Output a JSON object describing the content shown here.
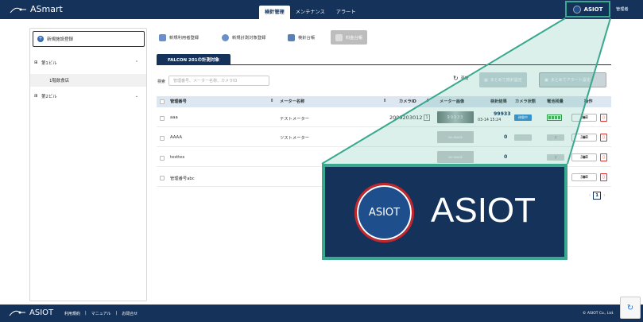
{
  "header": {
    "app_name": "ASmart",
    "tabs": [
      {
        "label": "検針管理",
        "active": true
      },
      {
        "label": "メンテナンス",
        "active": false
      },
      {
        "label": "アラート",
        "active": false
      }
    ],
    "brand": "ASIOT",
    "user": "管理者"
  },
  "sidebar": {
    "new_facility_label": "新規施設登録",
    "tree": [
      {
        "label": "第1ビル",
        "chevron": "^"
      },
      {
        "label": "1階飲食店",
        "sub": true
      },
      {
        "label": "第2ビル",
        "chevron": "v"
      }
    ]
  },
  "toolbar": {
    "new_user": "新規利用者登録",
    "new_target": "新規計測対象登録",
    "ledger": "検針台帳",
    "fee_ledger": "料金台帳"
  },
  "target_tab": "FALCON 201の計測対象",
  "search": {
    "label": "検索",
    "placeholder": "管理番号、メーター名称、カメラID"
  },
  "update_label": "更新",
  "bulk_buttons": {
    "config": "まとめて検針設定",
    "alert": "まとめてアラート設定"
  },
  "table": {
    "headers": [
      "管理番号",
      "メーター名称",
      "カメラID",
      "メーター画像",
      "検針結果",
      "カメラ状態",
      "電池残量",
      "操作"
    ],
    "rows": [
      {
        "id": "aaa",
        "meter": "テストメーター",
        "camera": "2009203012",
        "cam_tag": "1",
        "image": "REAL",
        "image_text": "99933",
        "value": "99933",
        "date": "03-14 15:24",
        "status": "稼働中",
        "status_color": "#3a8fd6",
        "battery": true
      },
      {
        "id": "AAAA",
        "meter": "ツストメーター",
        "camera": "",
        "cam_tag": "",
        "image": "NO IMAGE",
        "image_text": "NO IMAGE",
        "value": "0",
        "date": "",
        "status": "",
        "status_color": "#cfd4d4",
        "battery_q": "?"
      },
      {
        "id": "testtes",
        "meter": "",
        "camera": "",
        "cam_tag": "",
        "image": "NO IMAGE",
        "image_text": "NO IMAGE",
        "value": "0",
        "date": "",
        "status": "",
        "status_color": "#cfd4d4",
        "battery_q": "?"
      },
      {
        "id": "管理番号abc",
        "meter": "",
        "camera": "",
        "cam_tag": "",
        "image": "",
        "image_text": "",
        "value": "",
        "date": "",
        "status": "",
        "status_color": "",
        "battery_q": ""
      }
    ],
    "detail_label": "詳細",
    "delete_icon": "trash-icon"
  },
  "pagination": {
    "current": "1"
  },
  "zoom": {
    "circle_text": "ASIOT",
    "big_text": "ASIOT"
  },
  "footer": {
    "logo": "ASIOT",
    "links": [
      "利用規約",
      "マニュアル",
      "お問合せ"
    ],
    "copyright": "© ASIOT Co., Ltd."
  },
  "colors": {
    "navy": "#14325a",
    "teal": "#3aa88e",
    "red": "#c1272d"
  }
}
